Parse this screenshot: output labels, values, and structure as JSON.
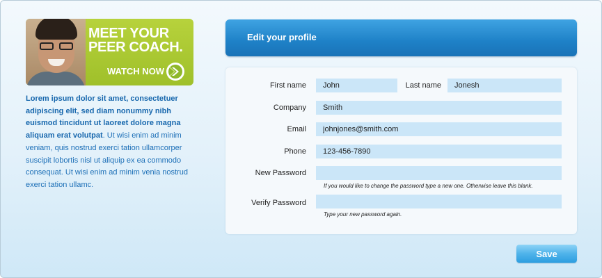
{
  "promo": {
    "headline_line1": "MEET YOUR",
    "headline_line2": "PEER COACH.",
    "cta": "WATCH NOW",
    "accent_color": "#a6c72f",
    "arrow_icon": "circle-arrow-right-icon"
  },
  "intro": {
    "bold_text": "Lorem ipsum dolor sit amet, consectetuer adipiscing elit, sed diam nonummy nibh euismod tincidunt ut laoreet dolore magna aliquam erat volutpat",
    "regular_text": ". Ut wisi enim ad minim veniam, quis nostrud exerci tation ullamcorper suscipit lobortis nisl ut aliquip ex ea commodo consequat. Ut wisi enim ad minim venia nostrud exerci tation ullamc."
  },
  "profile": {
    "title": "Edit your profile",
    "header_color": "#1e81c7"
  },
  "form": {
    "first_name": {
      "label": "First name",
      "value": "John"
    },
    "last_name": {
      "label": "Last name",
      "value": "Jonesh"
    },
    "company": {
      "label": "Company",
      "value": "Smith"
    },
    "email": {
      "label": "Email",
      "value": "johnjones@smith.com"
    },
    "phone": {
      "label": "Phone",
      "value": "123-456-7890"
    },
    "new_password": {
      "label": "New Password",
      "value": "",
      "hint": "If you would like to change the password type a new one. Otherwise leave this blank."
    },
    "verify_password": {
      "label": "Verify  Password",
      "value": "",
      "hint": "Type your new password again."
    },
    "field_color": "#cbe6f8"
  },
  "actions": {
    "save_label": "Save"
  }
}
